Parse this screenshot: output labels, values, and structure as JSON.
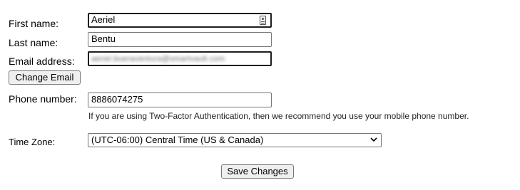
{
  "form": {
    "first_name": {
      "label": "First name:",
      "value": "Aeriel"
    },
    "last_name": {
      "label": "Last name:",
      "value": "Bentu"
    },
    "email": {
      "label": "Email address:",
      "value": "aeriel.bueraventura@smartvault.com"
    },
    "change_email_label": "Change Email",
    "phone": {
      "label": "Phone number:",
      "value": "8886074275",
      "help": "If you are using Two-Factor Authentication, then we recommend you use your mobile phone number."
    },
    "timezone": {
      "label": "Time Zone:",
      "selected": "(UTC-06:00) Central Time (US & Canada)"
    },
    "save_label": "Save Changes"
  },
  "icons": {
    "first_name_autofill": "contact-card-icon",
    "timezone_dropdown": "chevron-down-icon"
  }
}
